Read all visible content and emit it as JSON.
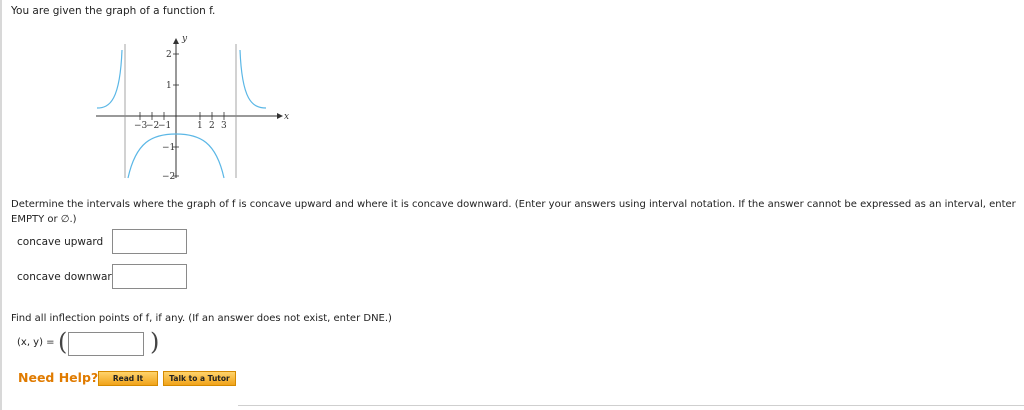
{
  "question": {
    "intro": "You are given the graph of a function f.",
    "instructions": "Determine the intervals where the graph of f is concave upward and where it is concave downward. (Enter your answers using interval notation. If the answer cannot be expressed as an interval, enter EMPTY or ∅.)",
    "inflection_prompt": "Find all inflection points of f, if any. (If an answer does not exist, enter DNE.)"
  },
  "graph": {
    "axis_x_label": "x",
    "axis_y_label": "y",
    "x_ticks": [
      "−3",
      "−2",
      "−1",
      "1",
      "2",
      "3"
    ],
    "y_ticks": [
      "2",
      "1",
      "−1",
      "−2"
    ],
    "curve_color": "#5bb7e6"
  },
  "fields": {
    "concave_upward_label": "concave upward",
    "concave_upward_value": "",
    "concave_downward_label": "concave downward",
    "concave_downward_value": "",
    "inflection_label": "(x, y) =",
    "inflection_value": ""
  },
  "help": {
    "label": "Need Help?",
    "read_it": "Read It",
    "talk_to_tutor": "Talk to a Tutor"
  }
}
